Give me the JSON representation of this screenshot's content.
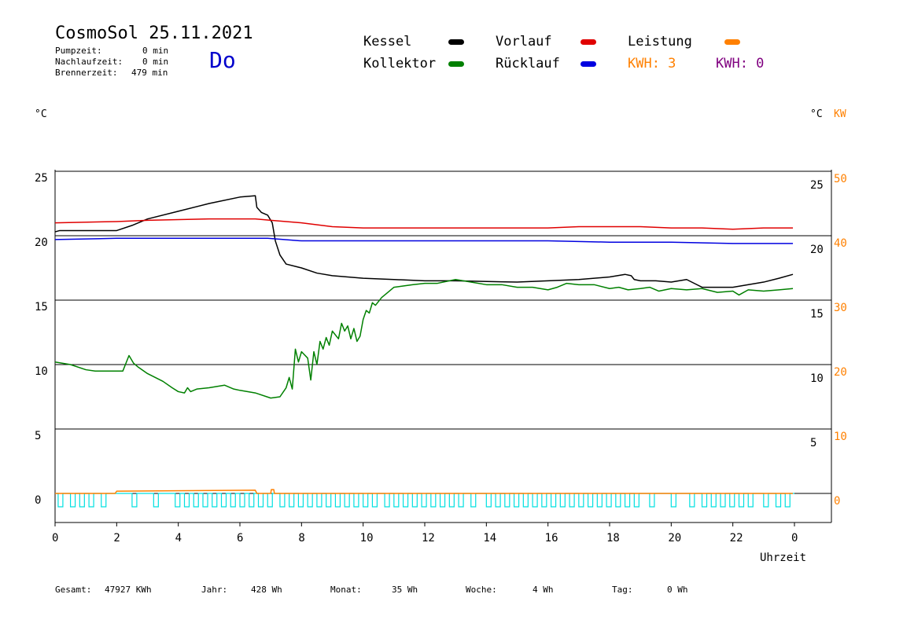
{
  "header": {
    "title": "CosmoSol 25.11.2021",
    "day": "Do",
    "pump_label": "Pumpzeit:",
    "pump_value": "0 min",
    "nachlauf_label": "Nachlaufzeit:",
    "nachlauf_value": "0 min",
    "brenner_label": "Brennerzeit:",
    "brenner_value": "479 min"
  },
  "legend": {
    "kessel": "Kessel",
    "kollektor": "Kollektor",
    "vorlauf": "Vorlauf",
    "ruecklauf": "Rücklauf",
    "leistung": "Leistung",
    "kwh1": "KWH: 3",
    "kwh2": "KWH: 0",
    "colors": {
      "kessel": "#000000",
      "kollektor": "#008000",
      "vorlauf": "#e00000",
      "ruecklauf": "#0000e0",
      "leistung": "#ff8000",
      "kwh2": "#800080",
      "pump": "#00e0e0"
    }
  },
  "axes": {
    "left_unit": "°C",
    "right_unit": "°C",
    "right_unit2": "KW",
    "x_label": "Uhrzeit"
  },
  "footer": {
    "gesamt_label": "Gesamt:",
    "gesamt": "47927 KWh",
    "jahr_label": "Jahr:",
    "jahr": "428 Wh",
    "monat_label": "Monat:",
    "monat": "35 Wh",
    "woche_label": "Woche:",
    "woche": "4 Wh",
    "tag_label": "Tag:",
    "tag": "0 Wh"
  },
  "chart_data": {
    "type": "line",
    "xlim": [
      0,
      24
    ],
    "ylim": [
      -2,
      25
    ],
    "y2lim": [
      -4,
      50
    ],
    "x_ticks": [
      "0",
      "2",
      "4",
      "6",
      "8",
      "10",
      "12",
      "14",
      "16",
      "18",
      "20",
      "22",
      "0"
    ],
    "y_ticks_left": [
      "25",
      "20",
      "15",
      "10",
      "5",
      "0"
    ],
    "y_ticks_right_c": [
      "25",
      "20",
      "15",
      "10",
      "5"
    ],
    "y_ticks_right_kw": [
      "50",
      "40",
      "30",
      "20",
      "10",
      "0"
    ],
    "grid": "horizontal",
    "series": [
      {
        "name": "Kessel",
        "color": "#000000",
        "x": [
          0,
          0.15,
          2.0,
          2.5,
          3.0,
          4.0,
          5.0,
          6.0,
          6.5,
          6.55,
          6.7,
          6.9,
          7.05,
          7.15,
          7.3,
          7.5,
          8.0,
          8.5,
          9.0,
          10.0,
          11.0,
          12.0,
          13.0,
          15.0,
          16.0,
          17.0,
          18.0,
          18.5,
          18.7,
          18.8,
          19.0,
          19.5,
          20.0,
          20.5,
          21.0,
          22.0,
          23.0,
          23.5,
          23.95
        ],
        "y": [
          20.3,
          20.4,
          20.4,
          20.8,
          21.3,
          21.9,
          22.5,
          23.0,
          23.1,
          22.2,
          21.8,
          21.6,
          21.0,
          19.6,
          18.5,
          17.8,
          17.5,
          17.1,
          16.9,
          16.7,
          16.6,
          16.5,
          16.5,
          16.4,
          16.5,
          16.6,
          16.8,
          17.0,
          16.9,
          16.6,
          16.5,
          16.5,
          16.4,
          16.6,
          16.0,
          16.0,
          16.4,
          16.7,
          17.0
        ]
      },
      {
        "name": "Vorlauf",
        "color": "#e00000",
        "x": [
          0,
          2.0,
          3.0,
          5.0,
          6.0,
          6.5,
          7.0,
          8.0,
          9.0,
          10.0,
          12.0,
          14.0,
          16.0,
          17.0,
          18.0,
          19.0,
          20.0,
          21.0,
          22.0,
          23.0,
          23.95
        ],
        "y": [
          21.0,
          21.1,
          21.2,
          21.3,
          21.3,
          21.3,
          21.2,
          21.0,
          20.7,
          20.6,
          20.6,
          20.6,
          20.6,
          20.7,
          20.7,
          20.7,
          20.6,
          20.6,
          20.5,
          20.6,
          20.6
        ]
      },
      {
        "name": "Rücklauf",
        "color": "#0000e0",
        "x": [
          0,
          2.0,
          4.0,
          6.0,
          6.9,
          8.0,
          10.0,
          12.0,
          14.0,
          16.0,
          18.0,
          20.0,
          22.0,
          23.95
        ],
        "y": [
          19.7,
          19.8,
          19.8,
          19.8,
          19.8,
          19.6,
          19.6,
          19.6,
          19.6,
          19.6,
          19.5,
          19.5,
          19.4,
          19.4
        ]
      },
      {
        "name": "Kollektor",
        "color": "#008000",
        "x": [
          0,
          0.5,
          1.0,
          1.3,
          1.8,
          2.2,
          2.4,
          2.55,
          2.7,
          3.0,
          3.5,
          3.8,
          4.0,
          4.2,
          4.3,
          4.4,
          4.6,
          5.0,
          5.5,
          5.8,
          6.0,
          6.5,
          7.0,
          7.3,
          7.5,
          7.6,
          7.7,
          7.8,
          7.9,
          8.0,
          8.2,
          8.3,
          8.4,
          8.5,
          8.6,
          8.7,
          8.8,
          8.9,
          9.0,
          9.2,
          9.3,
          9.4,
          9.5,
          9.6,
          9.7,
          9.8,
          9.9,
          10.0,
          10.1,
          10.2,
          10.3,
          10.4,
          10.6,
          10.8,
          11.0,
          11.3,
          11.6,
          12.0,
          12.4,
          12.8,
          13.0,
          13.5,
          14.0,
          14.5,
          15.0,
          15.5,
          16.0,
          16.3,
          16.6,
          17.0,
          17.5,
          18.0,
          18.3,
          18.6,
          19.0,
          19.3,
          19.6,
          20.0,
          20.5,
          21.0,
          21.5,
          22.0,
          22.2,
          22.5,
          23.0,
          23.5,
          23.95
        ],
        "y": [
          10.2,
          10.0,
          9.6,
          9.5,
          9.5,
          9.5,
          10.7,
          10.1,
          9.8,
          9.3,
          8.7,
          8.2,
          7.9,
          7.8,
          8.2,
          7.9,
          8.1,
          8.2,
          8.4,
          8.1,
          8.0,
          7.8,
          7.4,
          7.5,
          8.2,
          9.0,
          8.1,
          11.2,
          10.2,
          11.0,
          10.5,
          8.8,
          11.0,
          10.0,
          11.8,
          11.2,
          12.1,
          11.5,
          12.6,
          12.0,
          13.2,
          12.6,
          13.0,
          12.0,
          12.8,
          11.8,
          12.2,
          13.5,
          14.2,
          14.0,
          14.8,
          14.6,
          15.2,
          15.6,
          16.0,
          16.1,
          16.2,
          16.3,
          16.3,
          16.5,
          16.6,
          16.4,
          16.2,
          16.2,
          16.0,
          16.0,
          15.8,
          16.0,
          16.3,
          16.2,
          16.2,
          15.9,
          16.0,
          15.8,
          15.9,
          16.0,
          15.7,
          15.9,
          15.8,
          15.9,
          15.6,
          15.7,
          15.4,
          15.8,
          15.7,
          15.8,
          15.9
        ]
      },
      {
        "name": "Leistung",
        "color": "#ff8000",
        "x": [
          0,
          1.95,
          2.0,
          6.5,
          6.55,
          7.0,
          7.02,
          7.1,
          7.12,
          23.95
        ],
        "y": [
          0,
          0,
          0.35,
          0.5,
          0,
          0,
          0.6,
          0.6,
          0,
          0
        ]
      }
    ],
    "pump_pulses_x": [
      0.1,
      0.5,
      0.8,
      1.1,
      1.5,
      2.5,
      3.2,
      3.9,
      4.2,
      4.5,
      4.8,
      5.1,
      5.4,
      5.7,
      6.0,
      6.3,
      6.6,
      6.9,
      7.3,
      7.6,
      7.9,
      8.2,
      8.5,
      8.8,
      9.1,
      9.4,
      9.7,
      10.0,
      10.3,
      10.7,
      11.0,
      11.3,
      11.6,
      11.9,
      12.2,
      12.5,
      12.8,
      13.1,
      13.5,
      14.0,
      14.3,
      14.6,
      14.9,
      15.2,
      15.5,
      15.8,
      16.1,
      16.4,
      16.7,
      17.0,
      17.3,
      17.6,
      17.9,
      18.2,
      18.5,
      18.8,
      19.3,
      20.0,
      20.6,
      21.0,
      21.3,
      21.6,
      21.9,
      22.2,
      22.5,
      23.0,
      23.4,
      23.7
    ]
  }
}
